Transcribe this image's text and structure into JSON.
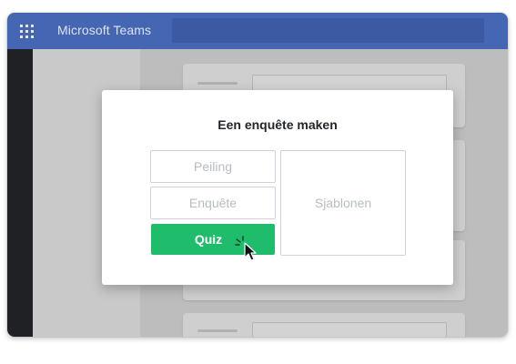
{
  "app": {
    "title": "Microsoft Teams"
  },
  "dialog": {
    "title": "Een enquête maken",
    "options": {
      "poll": "Peiling",
      "survey": "Enquête",
      "quiz": "Quiz",
      "templates": "Sjablonen"
    }
  },
  "colors": {
    "titlebar": "#4466b3",
    "rail": "#1f2124",
    "accent_green": "#1fbd6b"
  },
  "icons": [
    "app-launcher-icon",
    "click-burst-icon",
    "mouse-cursor-icon"
  ]
}
